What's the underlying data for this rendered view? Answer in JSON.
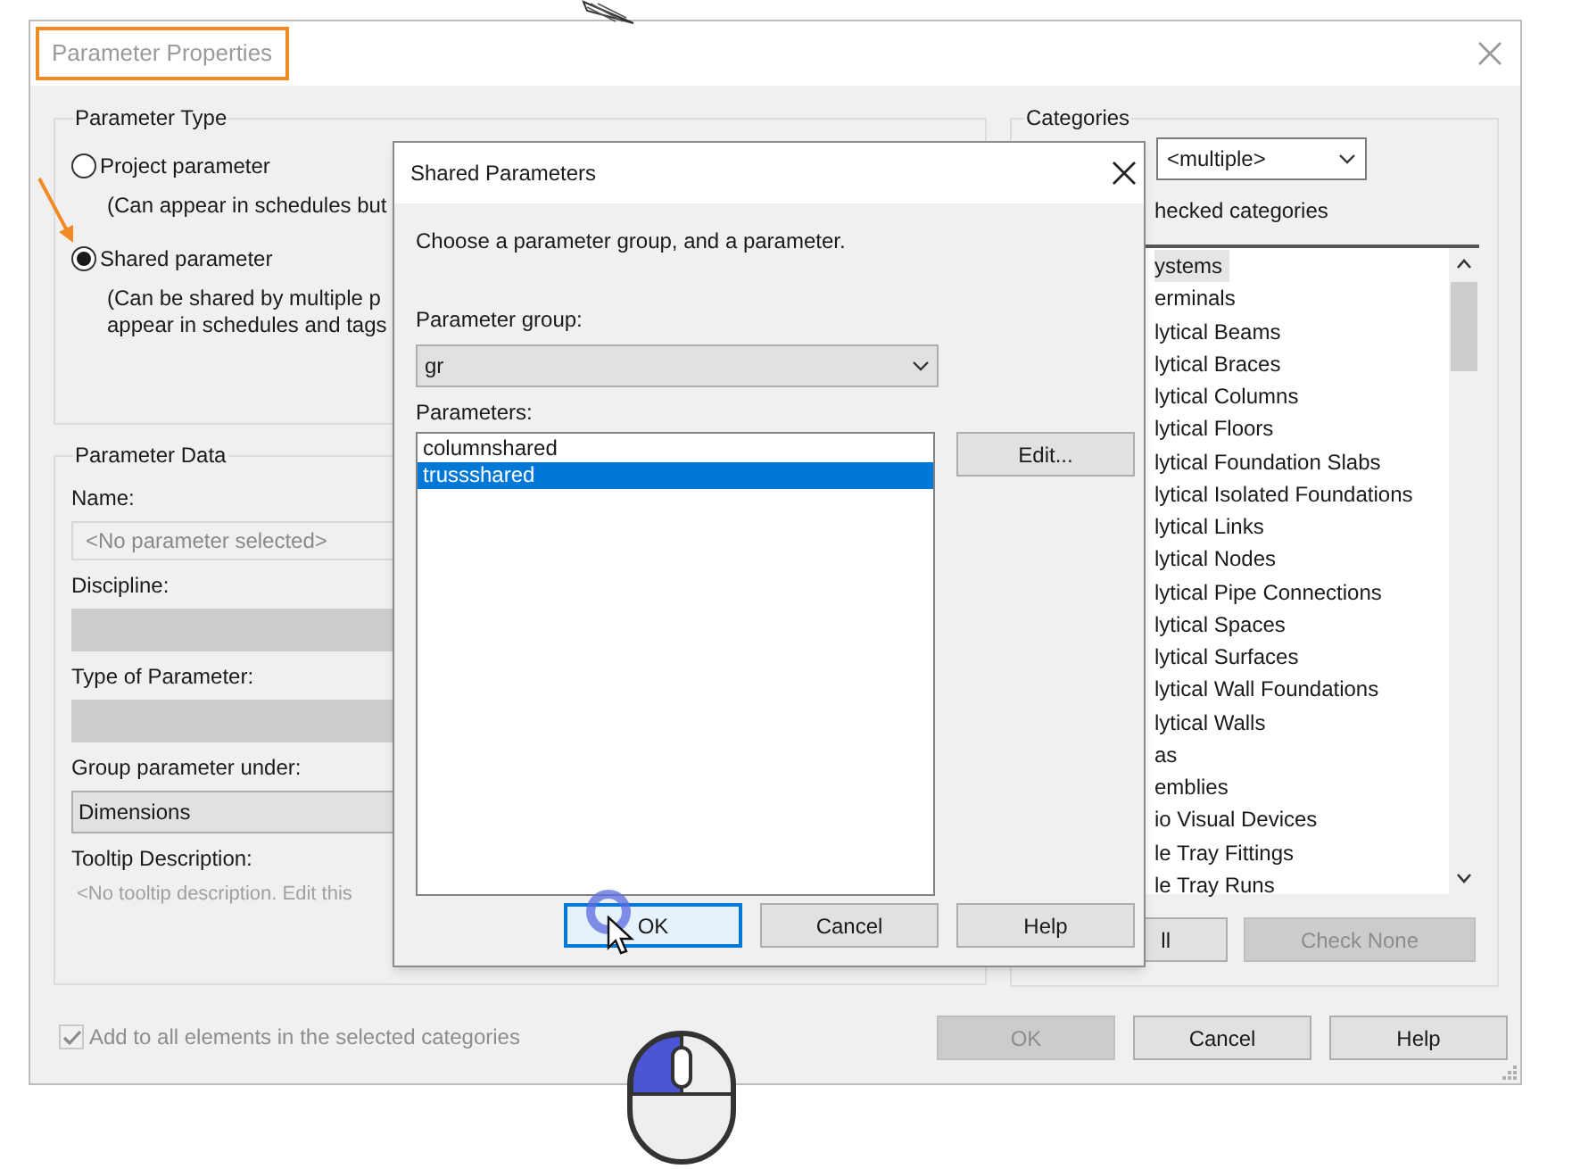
{
  "window": {
    "title": "Parameter Properties",
    "highlighted": true
  },
  "parameter_type": {
    "label": "Parameter Type",
    "options": [
      {
        "label": "Project parameter",
        "notes": [
          "(Can appear in schedules but"
        ],
        "selected": false
      },
      {
        "label": "Shared parameter",
        "notes": [
          "(Can be shared by multiple p",
          "appear in schedules and tags"
        ],
        "selected": true
      }
    ]
  },
  "parameter_data": {
    "label": "Parameter Data",
    "fields": [
      {
        "kind": "input",
        "label": "Name:",
        "placeholder": "<No parameter selected>"
      },
      {
        "kind": "disabled",
        "label": "Discipline:"
      },
      {
        "kind": "disabled",
        "label": "Type of Parameter:"
      },
      {
        "kind": "dropdown",
        "label": "Group parameter under:",
        "value": "Dimensions"
      },
      {
        "kind": "text",
        "label": "Tooltip Description:",
        "placeholder": "<No tooltip description. Edit this"
      }
    ]
  },
  "add_to_all": {
    "label": "Add to all elements in the selected categories",
    "checked": true,
    "disabled": true
  },
  "categories": {
    "label": "Categories",
    "filter": "<multiple>",
    "show_checked": "hecked categories",
    "items": [
      {
        "label": "ystems",
        "selected": true
      },
      {
        "label": "erminals",
        "selected": false
      },
      {
        "label": "lytical Beams",
        "selected": false
      },
      {
        "label": "lytical Braces",
        "selected": false
      },
      {
        "label": "lytical Columns",
        "selected": false
      },
      {
        "label": "lytical Floors",
        "selected": false
      },
      {
        "label": "lytical Foundation Slabs",
        "selected": false
      },
      {
        "label": "lytical Isolated Foundations",
        "selected": false
      },
      {
        "label": "lytical Links",
        "selected": false
      },
      {
        "label": "lytical Nodes",
        "selected": false
      },
      {
        "label": "lytical Pipe Connections",
        "selected": false
      },
      {
        "label": "lytical Spaces",
        "selected": false
      },
      {
        "label": "lytical Surfaces",
        "selected": false
      },
      {
        "label": "lytical Wall Foundations",
        "selected": false
      },
      {
        "label": "lytical Walls",
        "selected": false
      },
      {
        "label": "as",
        "selected": false
      },
      {
        "label": "emblies",
        "selected": false
      },
      {
        "label": "io Visual Devices",
        "selected": false
      },
      {
        "label": "le Tray Fittings",
        "selected": false
      },
      {
        "label": "le Tray Runs",
        "selected": false
      }
    ],
    "buttons": [
      {
        "label": "ll",
        "disabled": false
      },
      {
        "label": "Check None",
        "disabled": true
      }
    ]
  },
  "buttons": [
    {
      "label": "OK",
      "disabled": true
    },
    {
      "label": "Cancel",
      "disabled": false
    },
    {
      "label": "Help",
      "disabled": false
    }
  ],
  "shared_parameters_dialog": {
    "title": "Shared Parameters",
    "instruction": "Choose a parameter group, and a parameter.",
    "group_label": "Parameter group:",
    "group_value": "gr",
    "parameters_label": "Parameters:",
    "parameters": [
      {
        "label": "columnshared",
        "selected": false
      },
      {
        "label": "trussshared",
        "selected": true
      }
    ],
    "edit_button": "Edit...",
    "buttons": [
      {
        "label": "OK",
        "focused": true
      },
      {
        "label": "Cancel",
        "focused": false
      },
      {
        "label": "Help",
        "focused": false
      }
    ]
  }
}
